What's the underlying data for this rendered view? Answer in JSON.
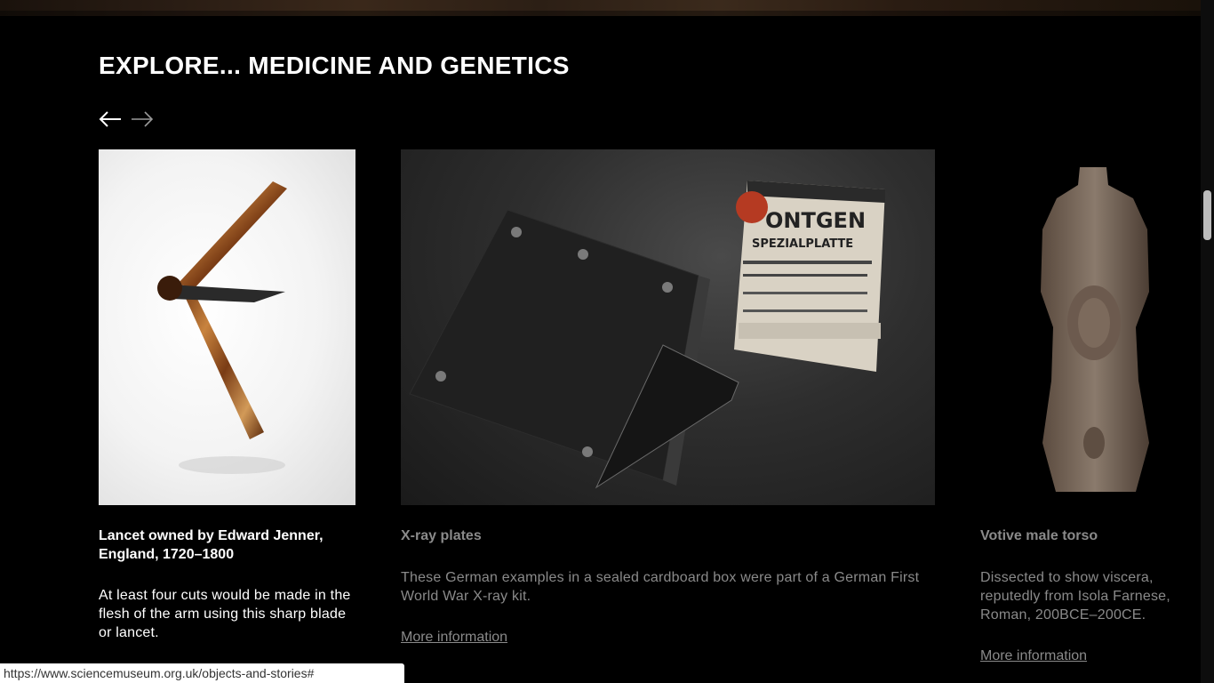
{
  "section": {
    "heading": "EXPLORE... MEDICINE AND GENETICS"
  },
  "nav": {
    "prev_icon": "arrow-left-icon",
    "next_icon": "arrow-right-icon"
  },
  "cards": [
    {
      "title": "Lancet owned by Edward Jenner, England, 1720–1800",
      "description": "At least four cuts would be made in the flesh of the arm using this sharp blade or lancet.",
      "link": "",
      "state": "active"
    },
    {
      "title": "X-ray plates",
      "description": "These German examples in a sealed cardboard box were part of a German First World War X-ray kit.",
      "link": "More information",
      "state": "dimmed",
      "box_label": "ONTGEN",
      "box_sublabel": "SPEZIALPLATTE"
    },
    {
      "title": "Votive male torso",
      "description": "Dissected to show viscera, reputedly from Isola Farnese, Roman, 200BCE–200CE.",
      "link": "More information",
      "state": "dimmed"
    }
  ],
  "status_bar": {
    "url": "https://www.sciencemuseum.org.uk/objects-and-stories#"
  },
  "colors": {
    "background": "#000000",
    "text": "#ffffff",
    "dimmed_text": "#8a8a8a"
  }
}
